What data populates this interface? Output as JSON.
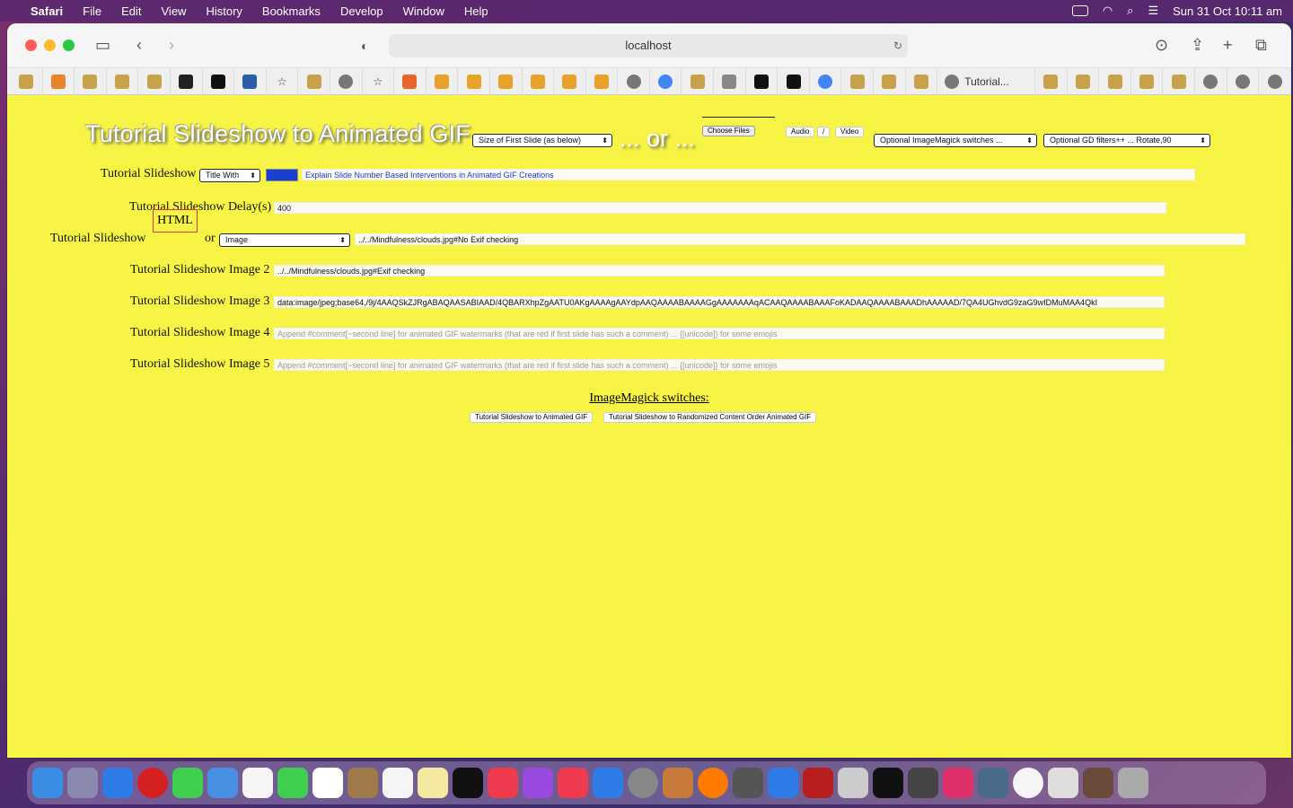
{
  "menubar": {
    "app": "Safari",
    "items": [
      "File",
      "Edit",
      "View",
      "History",
      "Bookmarks",
      "Develop",
      "Window",
      "Help"
    ],
    "datetime": "Sun 31 Oct  10:11 am"
  },
  "browser": {
    "url": "localhost",
    "active_tab": "Tutorial..."
  },
  "page": {
    "heading": "Tutorial Slideshow to Animated GIF",
    "size_select": "Size of First Slide (as below)",
    "or_text": "... or ...",
    "choose_files": "Choose Files",
    "audio_btn": "Audio",
    "slash": "/",
    "video_btn": "Video",
    "imagemagick_select": "Optional ImageMagick switches ...",
    "gd_select": "Optional GD filters++ ...   Rotate,90",
    "slideshow_label": "Tutorial Slideshow",
    "title_select": "Title With",
    "title_value": "Explain Slide Number Based Interventions in Animated GIF Creations",
    "delay_label": "Tutorial Slideshow Delay(s)",
    "delay_value": "400",
    "slideshow_label2": "Tutorial Slideshow",
    "html_btn": "HTML",
    "or_small": "or",
    "image_select": "Image",
    "image1_value": "../../Mindfulness/clouds.jpg#No Exif checking",
    "image2_label": "Tutorial Slideshow Image 2",
    "image2_value": "../../Mindfulness/clouds.jpg#Exif checking",
    "image3_label": "Tutorial Slideshow Image 3",
    "image3_value": "data:image/jpeg;base64,/9j/4AAQSkZJRgABAQAASABIAAD/4QBARXhpZgAATU0AKgAAAAgAAYdpAAQAAAABAAAAGgAAAAAAAqACAAQAAAABAAAFoKADAAQAAAABAAADhAAAAAD/7QA4UGhvdG9zaG9wIDMuMAA4QkI",
    "image4_label": "Tutorial Slideshow Image 4",
    "image4_placeholder": "Append #comment[~second line] for animated GIF watermarks (that are red if first slide has such a comment) ... {[unicode]} for some emojis",
    "image5_label": "Tutorial Slideshow Image 5",
    "image5_placeholder": "Append #comment[~second line] for animated GIF watermarks (that are red if first slide has such a comment) ... {[unicode]} for some emojis",
    "imagemagick_heading": "ImageMagick switches:",
    "btn_animated": "Tutorial Slideshow to Animated GIF",
    "btn_randomized": "Tutorial Slideshow to Randomized Content Order Animated GIF"
  },
  "colors": {
    "page_bg": "#f7f446",
    "title_color_swatch": "#1a3fd1"
  }
}
